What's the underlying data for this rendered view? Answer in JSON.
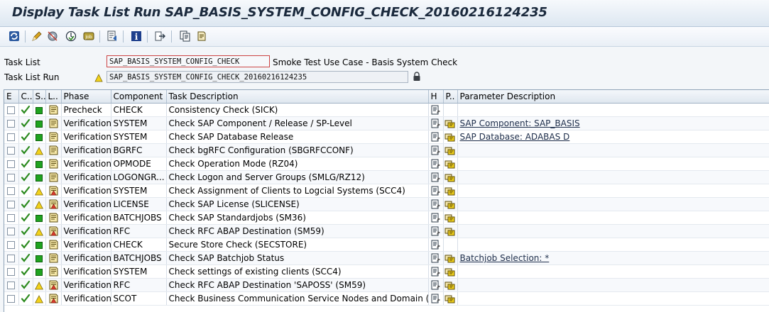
{
  "window": {
    "title": "Display Task List Run SAP_BASIS_SYSTEM_CONFIG_CHECK_20160216124235"
  },
  "toolbar": {
    "icons": [
      "refresh-icon",
      "edit-icon",
      "settings-icon",
      "check-icon",
      "job-icon",
      "export-icon",
      "info-icon",
      "navigate-icon",
      "copy-icon",
      "print-icon"
    ]
  },
  "header": {
    "task_list_label": "Task List",
    "task_list_value": "SAP_BASIS_SYSTEM_CONFIG_CHECK",
    "task_list_desc": "Smoke Test Use Case - Basis System Check",
    "run_label": "Task List Run",
    "run_value": "SAP_BASIS_SYSTEM_CONFIG_CHECK_20160216124235"
  },
  "table": {
    "columns": {
      "e": "E",
      "c": "C..",
      "s": "S..",
      "l": "L..",
      "phase": "Phase",
      "component": "Component",
      "desc": "Task Description",
      "h": "H",
      "p": "P..",
      "param": "Parameter Description"
    },
    "rows": [
      {
        "status": "green",
        "log": "ok",
        "phase": "Precheck",
        "component": "CHECK",
        "desc": "Consistency Check (SICK)",
        "param_icon": false,
        "param": ""
      },
      {
        "status": "green",
        "log": "ok",
        "phase": "Verification",
        "component": "SYSTEM",
        "desc": "Check SAP Component / Release / SP-Level",
        "param_icon": true,
        "param": "SAP Component: SAP_BASIS"
      },
      {
        "status": "green",
        "log": "ok",
        "phase": "Verification",
        "component": "SYSTEM",
        "desc": "Check SAP Database Release",
        "param_icon": true,
        "param": "SAP Database: ADABAS D"
      },
      {
        "status": "yellow",
        "log": "ok",
        "phase": "Verification",
        "component": "BGRFC",
        "desc": "Check bgRFC Configuration (SBGRFCCONF)",
        "param_icon": true,
        "param": ""
      },
      {
        "status": "green",
        "log": "ok",
        "phase": "Verification",
        "component": "OPMODE",
        "desc": "Check Operation Mode (RZ04)",
        "param_icon": true,
        "param": ""
      },
      {
        "status": "green",
        "log": "ok",
        "phase": "Verification",
        "component": "LOGONGR...",
        "desc": "Check Logon and Server Groups (SMLG/RZ12)",
        "param_icon": true,
        "param": ""
      },
      {
        "status": "yellow",
        "log": "warn",
        "phase": "Verification",
        "component": "SYSTEM",
        "desc": "Check Assignment of Clients to Logcial Systems (SCC4)",
        "param_icon": true,
        "param": ""
      },
      {
        "status": "yellow",
        "log": "warn",
        "phase": "Verification",
        "component": "LICENSE",
        "desc": "Check SAP License (SLICENSE)",
        "param_icon": true,
        "param": ""
      },
      {
        "status": "green",
        "log": "ok",
        "phase": "Verification",
        "component": "BATCHJOBS",
        "desc": "Check SAP Standardjobs (SM36)",
        "param_icon": true,
        "param": ""
      },
      {
        "status": "yellow",
        "log": "warn",
        "phase": "Verification",
        "component": "RFC",
        "desc": "Check RFC ABAP Destination (SM59)",
        "param_icon": true,
        "param": ""
      },
      {
        "status": "green",
        "log": "ok",
        "phase": "Verification",
        "component": "CHECK",
        "desc": "Secure Store Check (SECSTORE)",
        "param_icon": false,
        "param": ""
      },
      {
        "status": "green",
        "log": "ok",
        "phase": "Verification",
        "component": "BATCHJOBS",
        "desc": "Check SAP Batchjob Status",
        "param_icon": true,
        "param": "Batchjob Selection: *"
      },
      {
        "status": "green",
        "log": "ok",
        "phase": "Verification",
        "component": "SYSTEM",
        "desc": "Check settings of existing clients (SCC4)",
        "param_icon": true,
        "param": ""
      },
      {
        "status": "yellow",
        "log": "warn",
        "phase": "Verification",
        "component": "RFC",
        "desc": "Check RFC ABAP Destination 'SAPOSS' (SM59)",
        "param_icon": true,
        "param": ""
      },
      {
        "status": "yellow",
        "log": "warn",
        "phase": "Verification",
        "component": "SCOT",
        "desc": "Check Business Communication Service Nodes and Domain (SCOT)",
        "param_icon": true,
        "param": ""
      }
    ]
  },
  "colors": {
    "ok_green": "#1fa31f",
    "warn_yellow": "#f2d21b",
    "check_green": "#2b8a1e"
  }
}
